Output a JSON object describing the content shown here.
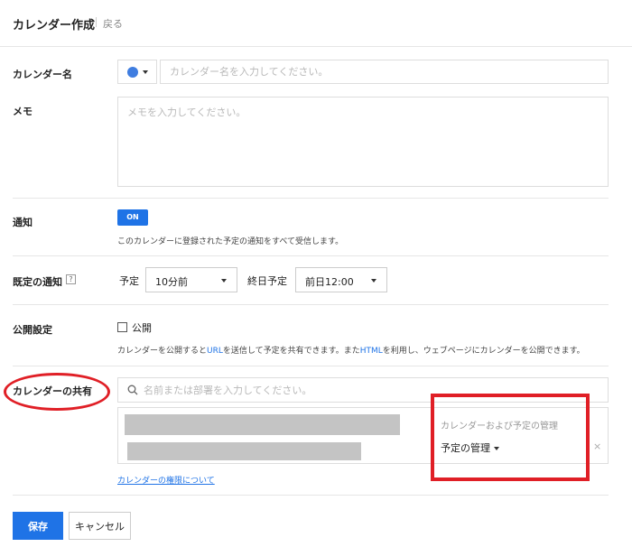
{
  "header": {
    "title": "カレンダー作成",
    "back_label": "戻る"
  },
  "calendar_name": {
    "label": "カレンダー名",
    "color": "#3f7de0",
    "placeholder": "カレンダー名を入力してください。"
  },
  "memo": {
    "label": "メモ",
    "placeholder": "メモを入力してください。"
  },
  "notification": {
    "label": "通知",
    "toggle_label": "ON",
    "description": "このカレンダーに登録された予定の通知をすべて受信します。"
  },
  "default_notification": {
    "label": "既定の通知",
    "help_icon": "?",
    "event_label": "予定",
    "event_value": "10分前",
    "allday_label": "終日予定",
    "allday_value": "前日12:00"
  },
  "public_setting": {
    "label": "公開設定",
    "checkbox_label": "公開",
    "desc_part1": "カレンダーを公開すると",
    "desc_link1": "URL",
    "desc_part2": "を送信して予定を共有できます。また",
    "desc_link2": "HTML",
    "desc_part3": "を利用し、ウェブページにカレンダーを公開できます。"
  },
  "sharing": {
    "label": "カレンダーの共有",
    "search_placeholder": "名前または部署を入力してください。",
    "permission_title": "カレンダーおよび予定の管理",
    "permission_value": "予定の管理",
    "remove_label": "×",
    "permission_link": "カレンダーの権限について"
  },
  "actions": {
    "save_label": "保存",
    "cancel_label": "キャンセル"
  },
  "colors": {
    "accent": "#1f73e6",
    "annotation_red": "#e01f26"
  }
}
